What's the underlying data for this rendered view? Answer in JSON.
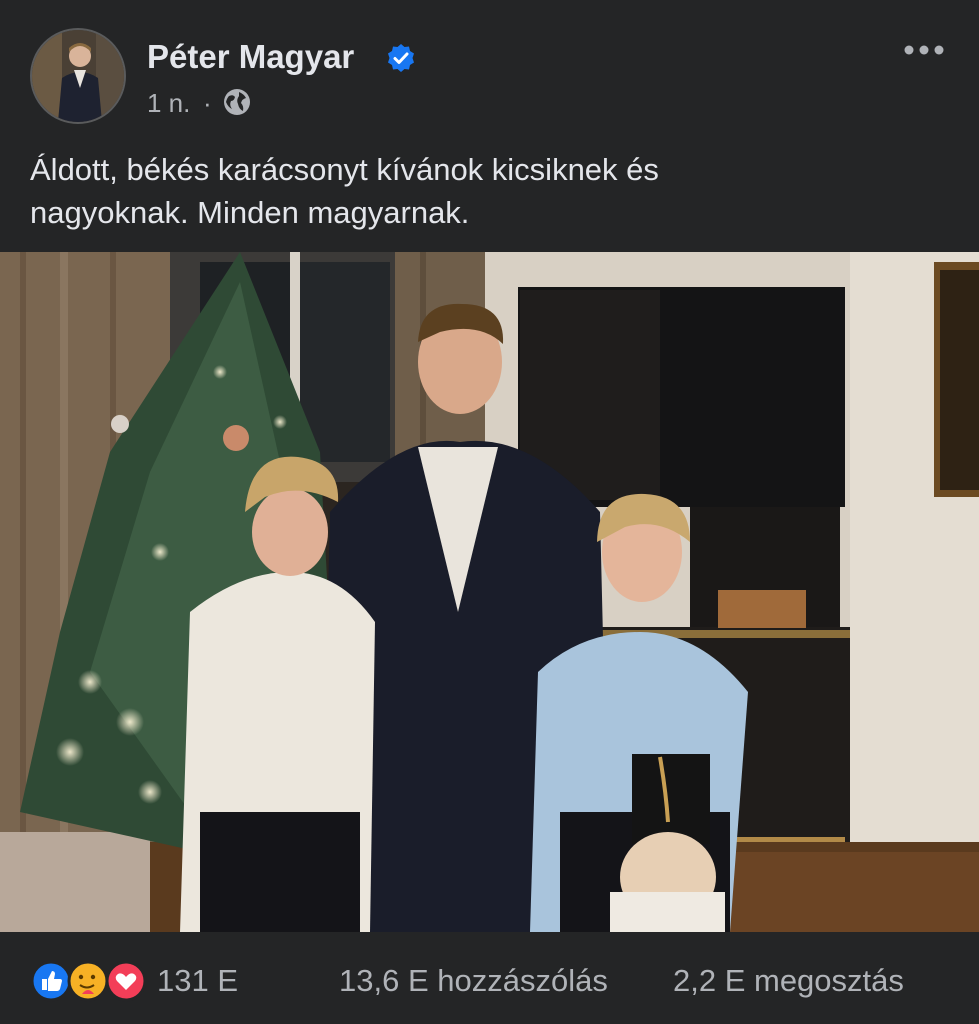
{
  "post": {
    "author": {
      "name": "Péter Magyar",
      "verified": true
    },
    "meta": {
      "time": "1 n.",
      "separator": "·",
      "audience_icon": "globe-icon"
    },
    "text_line1": "Áldott, békés karácsonyt kívánok kicsiknek és",
    "text_line2": "nagyoknak. Minden magyarnak."
  },
  "engagement": {
    "reactions": [
      "like-icon",
      "care-icon",
      "love-icon"
    ],
    "reaction_count": "131 E",
    "comments": "13,6 E hozzászólás",
    "shares": "2,2 E megosztás"
  },
  "colors": {
    "background": "#242526",
    "text_primary": "#e4e6eb",
    "text_secondary": "#b0b3b8",
    "verified_blue": "#1877f2",
    "like_blue": "#1877f2",
    "love_red": "#f33e58",
    "care_yellow": "#f7b125"
  }
}
